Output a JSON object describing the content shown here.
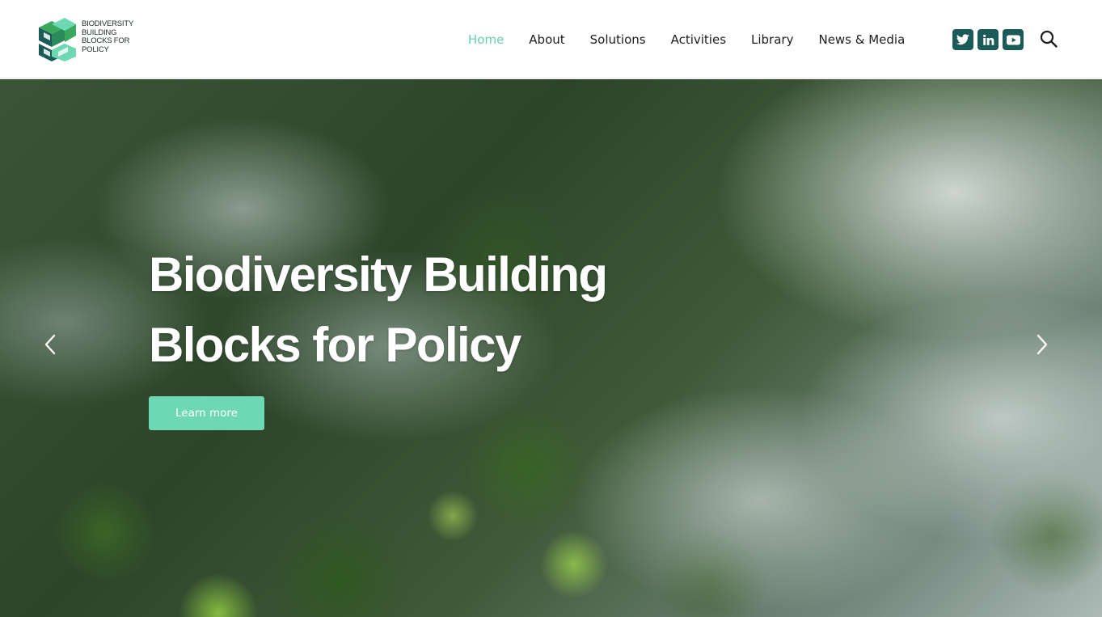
{
  "header": {
    "logo": {
      "lines": [
        "BIODIVERSITY",
        "BUILDING",
        "BLOCKS FOR",
        "POLICY"
      ],
      "colors": {
        "dark_green": "#1a5a57",
        "mid_green": "#3aa85c",
        "light_green": "#6ed8b5"
      }
    },
    "nav": [
      {
        "label": "Home",
        "active": true
      },
      {
        "label": "About",
        "active": false
      },
      {
        "label": "Solutions",
        "active": false
      },
      {
        "label": "Activities",
        "active": false
      },
      {
        "label": "Library",
        "active": false
      },
      {
        "label": "News & Media",
        "active": false
      }
    ],
    "social": [
      {
        "icon": "twitter-icon"
      },
      {
        "icon": "linkedin-icon"
      },
      {
        "icon": "youtube-icon"
      }
    ],
    "search_icon": "search-icon"
  },
  "hero": {
    "title": "Biodiversity Building Blocks for Policy",
    "cta_label": "Learn more",
    "prev_icon": "chevron-left-icon",
    "next_icon": "chevron-right-icon"
  },
  "colors": {
    "accent": "#66cfae",
    "button": "#6ed8b5",
    "social_bg": "#1a5a57",
    "nav_text": "#1d1d1d"
  }
}
